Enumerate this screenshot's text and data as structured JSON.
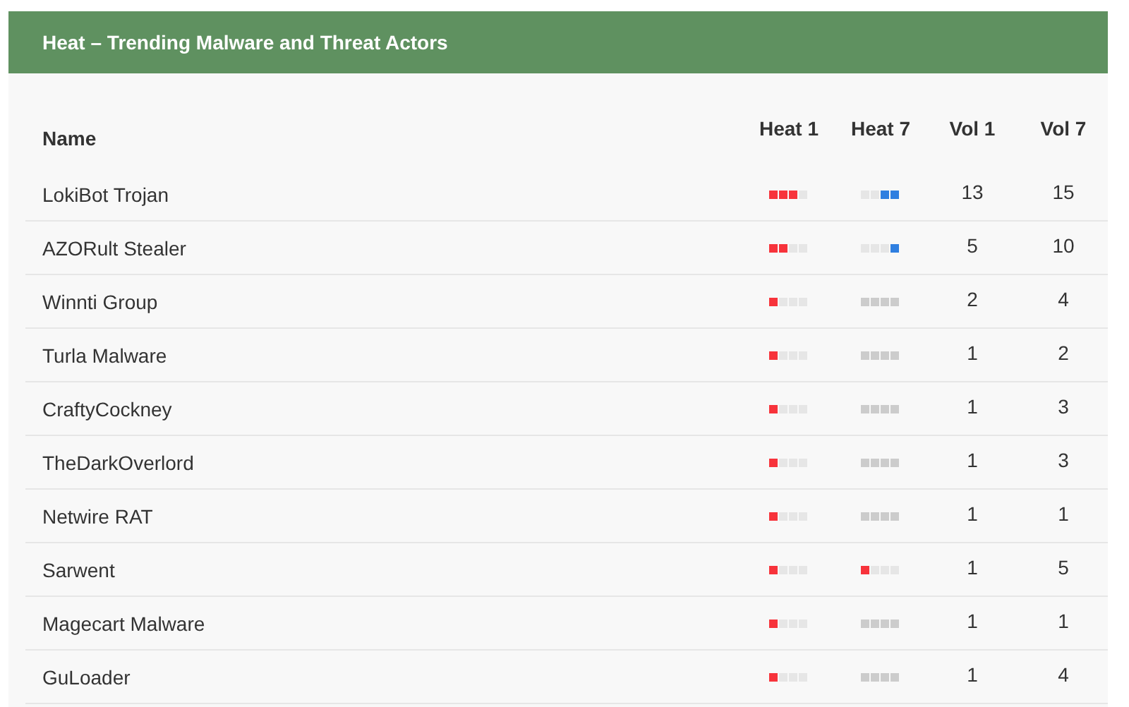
{
  "title": "Heat – Trending Malware and Threat Actors",
  "columns": [
    "Name",
    "Heat 1",
    "Heat 7",
    "Vol 1",
    "Vol 7"
  ],
  "rows": [
    {
      "name": "LokiBot Trojan",
      "heat_1": {
        "kind": "leading",
        "level": 0.75,
        "color": "#f7333b"
      },
      "heat_7": {
        "kind": "trailing",
        "level": 0.5,
        "color": "#2f7fe0"
      },
      "vol_1": "13",
      "vol_7": "15"
    },
    {
      "name": "AZORult Stealer",
      "heat_1": {
        "kind": "leading",
        "level": 0.5,
        "color": "#f7333b"
      },
      "heat_7": {
        "kind": "trailing",
        "level": 0.25,
        "color": "#2f7fe0"
      },
      "vol_1": "5",
      "vol_7": "10"
    },
    {
      "name": "Winnti Group",
      "heat_1": {
        "kind": "leading",
        "level": 0.25,
        "color": "#f7333b"
      },
      "heat_7": {
        "kind": "empty"
      },
      "vol_1": "2",
      "vol_7": "4"
    },
    {
      "name": "Turla Malware",
      "heat_1": {
        "kind": "leading",
        "level": 0.25,
        "color": "#f7333b"
      },
      "heat_7": {
        "kind": "empty"
      },
      "vol_1": "1",
      "vol_7": "2"
    },
    {
      "name": "CraftyCockney",
      "heat_1": {
        "kind": "leading",
        "level": 0.25,
        "color": "#f7333b"
      },
      "heat_7": {
        "kind": "empty"
      },
      "vol_1": "1",
      "vol_7": "3"
    },
    {
      "name": "TheDarkOverlord",
      "heat_1": {
        "kind": "leading",
        "level": 0.25,
        "color": "#f7333b"
      },
      "heat_7": {
        "kind": "empty"
      },
      "vol_1": "1",
      "vol_7": "3"
    },
    {
      "name": "Netwire RAT",
      "heat_1": {
        "kind": "leading",
        "level": 0.25,
        "color": "#f7333b"
      },
      "heat_7": {
        "kind": "empty"
      },
      "vol_1": "1",
      "vol_7": "1"
    },
    {
      "name": "Sarwent",
      "heat_1": {
        "kind": "leading",
        "level": 0.25,
        "color": "#f7333b"
      },
      "heat_7": {
        "kind": "leading",
        "level": 0.25,
        "color": "#f7333b"
      },
      "vol_1": "1",
      "vol_7": "5"
    },
    {
      "name": "Magecart Malware",
      "heat_1": {
        "kind": "leading",
        "level": 0.25,
        "color": "#f7333b"
      },
      "heat_7": {
        "kind": "empty"
      },
      "vol_1": "1",
      "vol_7": "1"
    },
    {
      "name": "GuLoader",
      "heat_1": {
        "kind": "leading",
        "level": 0.25,
        "color": "#f7333b"
      },
      "heat_7": {
        "kind": "empty"
      },
      "vol_1": "1",
      "vol_7": "4"
    }
  ]
}
